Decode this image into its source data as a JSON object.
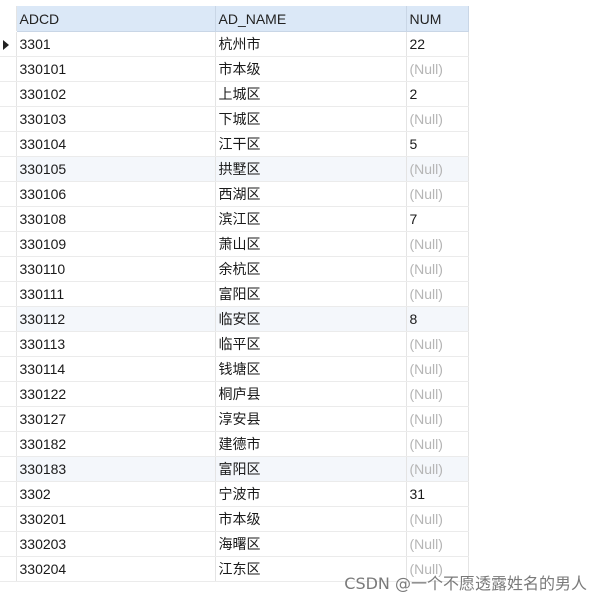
{
  "grid": {
    "columns": [
      "ADCD",
      "AD_NAME",
      "NUM"
    ],
    "current_row_index": 0,
    "rows": [
      {
        "adcd": "3301",
        "name": "杭州市",
        "num": "22",
        "is_null": false
      },
      {
        "adcd": "330101",
        "name": "市本级",
        "num": "(Null)",
        "is_null": true
      },
      {
        "adcd": "330102",
        "name": "上城区",
        "num": "2",
        "is_null": false
      },
      {
        "adcd": "330103",
        "name": "下城区",
        "num": "(Null)",
        "is_null": true
      },
      {
        "adcd": "330104",
        "name": "江干区",
        "num": "5",
        "is_null": false
      },
      {
        "adcd": "330105",
        "name": "拱墅区",
        "num": "(Null)",
        "is_null": true
      },
      {
        "adcd": "330106",
        "name": "西湖区",
        "num": "(Null)",
        "is_null": true
      },
      {
        "adcd": "330108",
        "name": "滨江区",
        "num": "7",
        "is_null": false
      },
      {
        "adcd": "330109",
        "name": "萧山区",
        "num": "(Null)",
        "is_null": true
      },
      {
        "adcd": "330110",
        "name": "余杭区",
        "num": "(Null)",
        "is_null": true
      },
      {
        "adcd": "330111",
        "name": "富阳区",
        "num": "(Null)",
        "is_null": true
      },
      {
        "adcd": "330112",
        "name": "临安区",
        "num": "8",
        "is_null": false
      },
      {
        "adcd": "330113",
        "name": "临平区",
        "num": "(Null)",
        "is_null": true
      },
      {
        "adcd": "330114",
        "name": "钱塘区",
        "num": "(Null)",
        "is_null": true
      },
      {
        "adcd": "330122",
        "name": "桐庐县",
        "num": "(Null)",
        "is_null": true
      },
      {
        "adcd": "330127",
        "name": "淳安县",
        "num": "(Null)",
        "is_null": true
      },
      {
        "adcd": "330182",
        "name": "建德市",
        "num": "(Null)",
        "is_null": true
      },
      {
        "adcd": "330183",
        "name": "富阳区",
        "num": "(Null)",
        "is_null": true
      },
      {
        "adcd": "3302",
        "name": "宁波市",
        "num": "31",
        "is_null": false
      },
      {
        "adcd": "330201",
        "name": "市本级",
        "num": "(Null)",
        "is_null": true
      },
      {
        "adcd": "330203",
        "name": "海曙区",
        "num": "(Null)",
        "is_null": true
      },
      {
        "adcd": "330204",
        "name": "江东区",
        "num": "(Null)",
        "is_null": true
      }
    ]
  },
  "watermark": "CSDN @一个不愿透露姓名的男人",
  "colors": {
    "header_bg": "#dbe8f7",
    "null_text": "#b5b5b5",
    "alt_row_bg": "#f4f7fb"
  }
}
